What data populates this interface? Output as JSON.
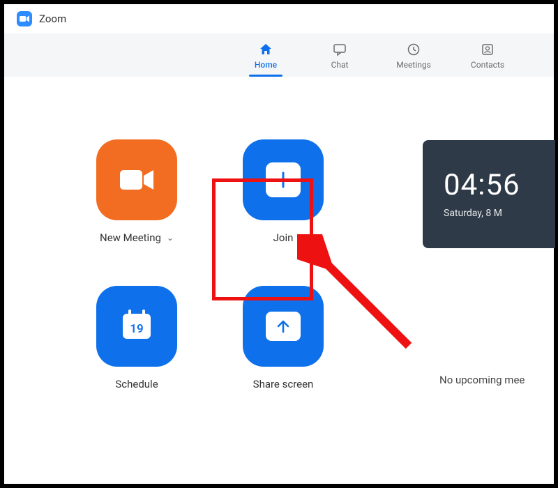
{
  "app": {
    "title": "Zoom"
  },
  "tabs": {
    "home": "Home",
    "chat": "Chat",
    "meetings": "Meetings",
    "contacts": "Contacts"
  },
  "actions": {
    "new_meeting": "New Meeting",
    "join": "Join",
    "schedule": "Schedule",
    "schedule_day": "19",
    "share_screen": "Share screen"
  },
  "clock": {
    "time": "04:56",
    "date": "Saturday, 8 M"
  },
  "status": {
    "no_meetings": "No upcoming mee"
  },
  "colors": {
    "primary_blue": "#0E71EB",
    "orange": "#F26D21",
    "clock_bg": "#2E3A47",
    "highlight_red": "#e11"
  }
}
